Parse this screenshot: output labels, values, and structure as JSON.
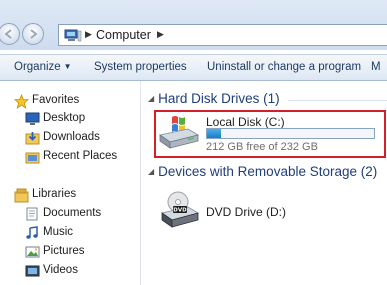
{
  "address_bar": {
    "crumbs": [
      "Computer"
    ]
  },
  "command_bar": {
    "organize": "Organize",
    "system_properties": "System properties",
    "uninstall": "Uninstall or change a program",
    "more": "M"
  },
  "nav_pane": {
    "favorites": {
      "label": "Favorites",
      "items": [
        {
          "label": "Desktop",
          "icon": "desktop-icon"
        },
        {
          "label": "Downloads",
          "icon": "downloads-icon"
        },
        {
          "label": "Recent Places",
          "icon": "recent-places-icon"
        }
      ]
    },
    "libraries": {
      "label": "Libraries",
      "items": [
        {
          "label": "Documents",
          "icon": "documents-icon"
        },
        {
          "label": "Music",
          "icon": "music-icon"
        },
        {
          "label": "Pictures",
          "icon": "pictures-icon"
        },
        {
          "label": "Videos",
          "icon": "videos-icon"
        }
      ]
    }
  },
  "content": {
    "hard_disk_group": {
      "title": "Hard Disk Drives (1)",
      "drives": [
        {
          "name": "Local Disk (C:)",
          "free_text": "212 GB free of 232 GB",
          "used_fraction": 0.086
        }
      ]
    },
    "removable_group": {
      "title": "Devices with Removable Storage (2)",
      "drives": [
        {
          "name": "DVD Drive (D:)",
          "icon_label": "DVD"
        }
      ]
    }
  },
  "colors": {
    "highlight_border": "#d21f2a",
    "usage_fill": "#1b7cc8",
    "group_header": "#1f3e7c"
  }
}
